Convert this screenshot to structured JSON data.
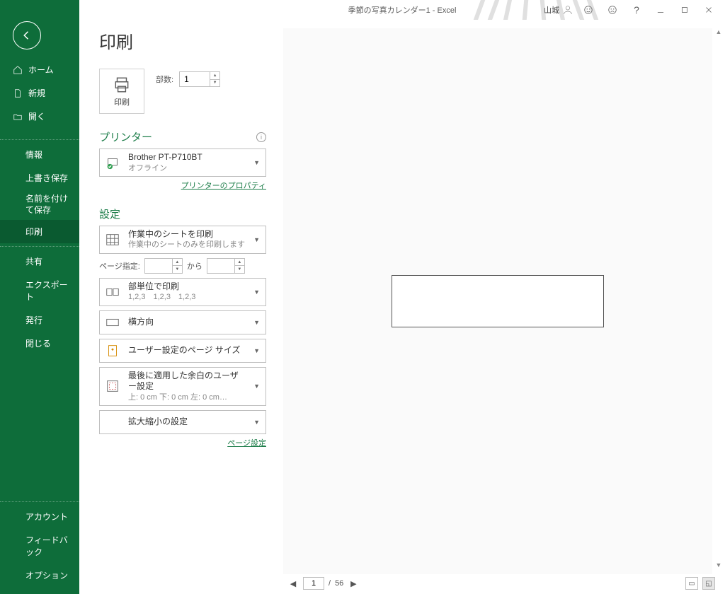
{
  "titlebar": {
    "document": "季節の写真カレンダー1  -  Excel",
    "username": "山城"
  },
  "sidebar": {
    "home": "ホーム",
    "new": "新規",
    "open": "開く",
    "info": "情報",
    "save": "上書き保存",
    "saveas": "名前を付けて保存",
    "print": "印刷",
    "share": "共有",
    "export": "エクスポート",
    "publish": "発行",
    "close": "閉じる",
    "account": "アカウント",
    "feedback": "フィードバック",
    "options": "オプション"
  },
  "page_title": "印刷",
  "print": {
    "button_label": "印刷",
    "copies_label": "部数:",
    "copies_value": "1"
  },
  "printer": {
    "heading": "プリンター",
    "name": "Brother PT-P710BT",
    "status": "オフライン",
    "properties_link": "プリンターのプロパティ"
  },
  "settings": {
    "heading": "設定",
    "what": {
      "t1": "作業中のシートを印刷",
      "t2": "作業中のシートのみを印刷します"
    },
    "pages": {
      "label": "ページ指定:",
      "from": "",
      "to_label": "から",
      "to": ""
    },
    "collate": {
      "t1": "部単位で印刷",
      "t2": "1,2,3　1,2,3　1,2,3"
    },
    "orientation": {
      "t1": "横方向"
    },
    "pagesize": {
      "t1": "ユーザー設定のページ サイズ"
    },
    "margins": {
      "t1": "最後に適用した余白のユーザー設定",
      "t2": "上: 0 cm 下: 0 cm 左: 0 cm…"
    },
    "scaling": {
      "t1": "拡大縮小の設定"
    },
    "page_setup_link": "ページ設定"
  },
  "preview": {
    "current_page": "1",
    "total_pages": "56",
    "sep": "/"
  }
}
